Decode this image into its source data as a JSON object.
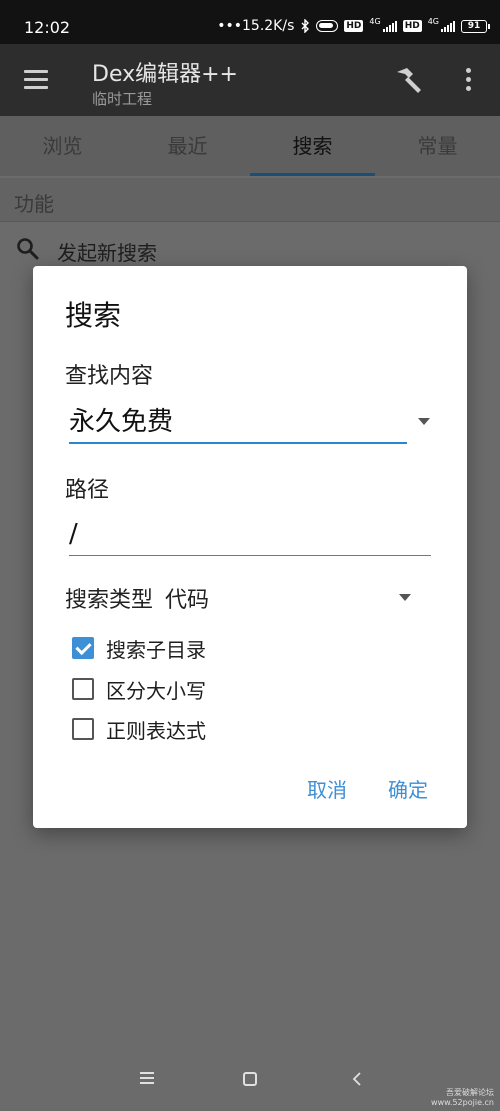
{
  "status_bar": {
    "time": "12:02",
    "net_speed": "15.2K/s",
    "net_type_1": "4G",
    "net_type_2": "4G",
    "hd_badge": "HD",
    "battery": "91"
  },
  "app_bar": {
    "title": "Dex编辑器++",
    "subtitle": "临时工程"
  },
  "tabs": [
    {
      "label": "浏览"
    },
    {
      "label": "最近"
    },
    {
      "label": "搜索"
    },
    {
      "label": "常量"
    }
  ],
  "section": {
    "label": "功能",
    "new_search": "发起新搜索"
  },
  "dialog": {
    "title": "搜索",
    "query_label": "查找内容",
    "query_value": "永久免费",
    "path_label": "路径",
    "path_value": "/",
    "search_type_label": "搜索类型",
    "search_type_value": "代码",
    "options": [
      {
        "label": "搜索子目录",
        "checked": true
      },
      {
        "label": "区分大小写",
        "checked": false
      },
      {
        "label": "正则表达式",
        "checked": false
      }
    ],
    "cancel": "取消",
    "confirm": "确定"
  },
  "watermark": {
    "line1": "吾爱破解论坛",
    "line2": "www.52pojie.cn"
  },
  "colors": {
    "accent": "#3d8fd6",
    "underline": "#2b86d0",
    "app_bar": "#2d2d2d"
  }
}
